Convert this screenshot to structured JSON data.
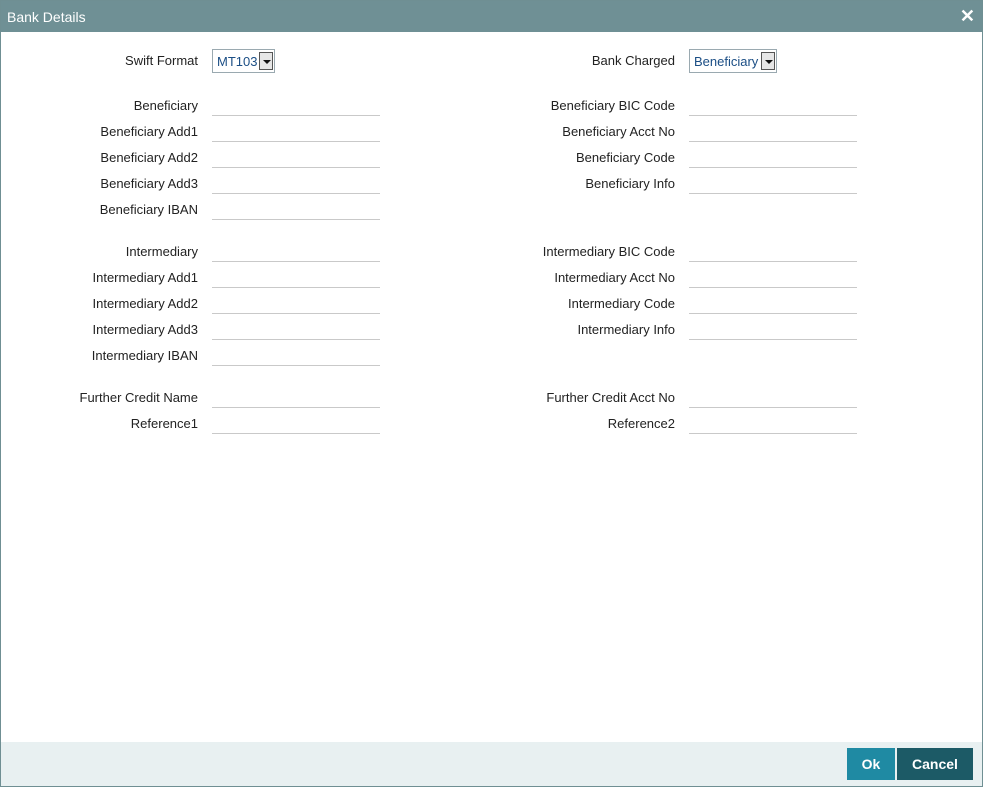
{
  "window": {
    "title": "Bank Details",
    "close_glyph": "✕"
  },
  "fields": {
    "swift_format": {
      "label": "Swift Format",
      "value": "MT103"
    },
    "bank_charged": {
      "label": "Bank Charged",
      "value": "Beneficiary"
    },
    "beneficiary": {
      "label": "Beneficiary",
      "value": ""
    },
    "beneficiary_add1": {
      "label": "Beneficiary Add1",
      "value": ""
    },
    "beneficiary_add2": {
      "label": "Beneficiary Add2",
      "value": ""
    },
    "beneficiary_add3": {
      "label": "Beneficiary Add3",
      "value": ""
    },
    "beneficiary_iban": {
      "label": "Beneficiary IBAN",
      "value": ""
    },
    "beneficiary_bic_code": {
      "label": "Beneficiary BIC Code",
      "value": ""
    },
    "beneficiary_acct_no": {
      "label": "Beneficiary Acct No",
      "value": ""
    },
    "beneficiary_code": {
      "label": "Beneficiary Code",
      "value": ""
    },
    "beneficiary_info": {
      "label": "Beneficiary Info",
      "value": ""
    },
    "intermediary": {
      "label": "Intermediary",
      "value": ""
    },
    "intermediary_add1": {
      "label": "Intermediary Add1",
      "value": ""
    },
    "intermediary_add2": {
      "label": "Intermediary Add2",
      "value": ""
    },
    "intermediary_add3": {
      "label": "Intermediary Add3",
      "value": ""
    },
    "intermediary_iban": {
      "label": "Intermediary IBAN",
      "value": ""
    },
    "intermediary_bic_code": {
      "label": "Intermediary BIC Code",
      "value": ""
    },
    "intermediary_acct_no": {
      "label": "Intermediary Acct No",
      "value": ""
    },
    "intermediary_code": {
      "label": "Intermediary Code",
      "value": ""
    },
    "intermediary_info": {
      "label": "Intermediary Info",
      "value": ""
    },
    "further_credit_name": {
      "label": "Further Credit Name",
      "value": ""
    },
    "further_credit_acct_no": {
      "label": "Further Credit Acct No",
      "value": ""
    },
    "reference1": {
      "label": "Reference1",
      "value": ""
    },
    "reference2": {
      "label": "Reference2",
      "value": ""
    }
  },
  "buttons": {
    "ok": "Ok",
    "cancel": "Cancel"
  }
}
